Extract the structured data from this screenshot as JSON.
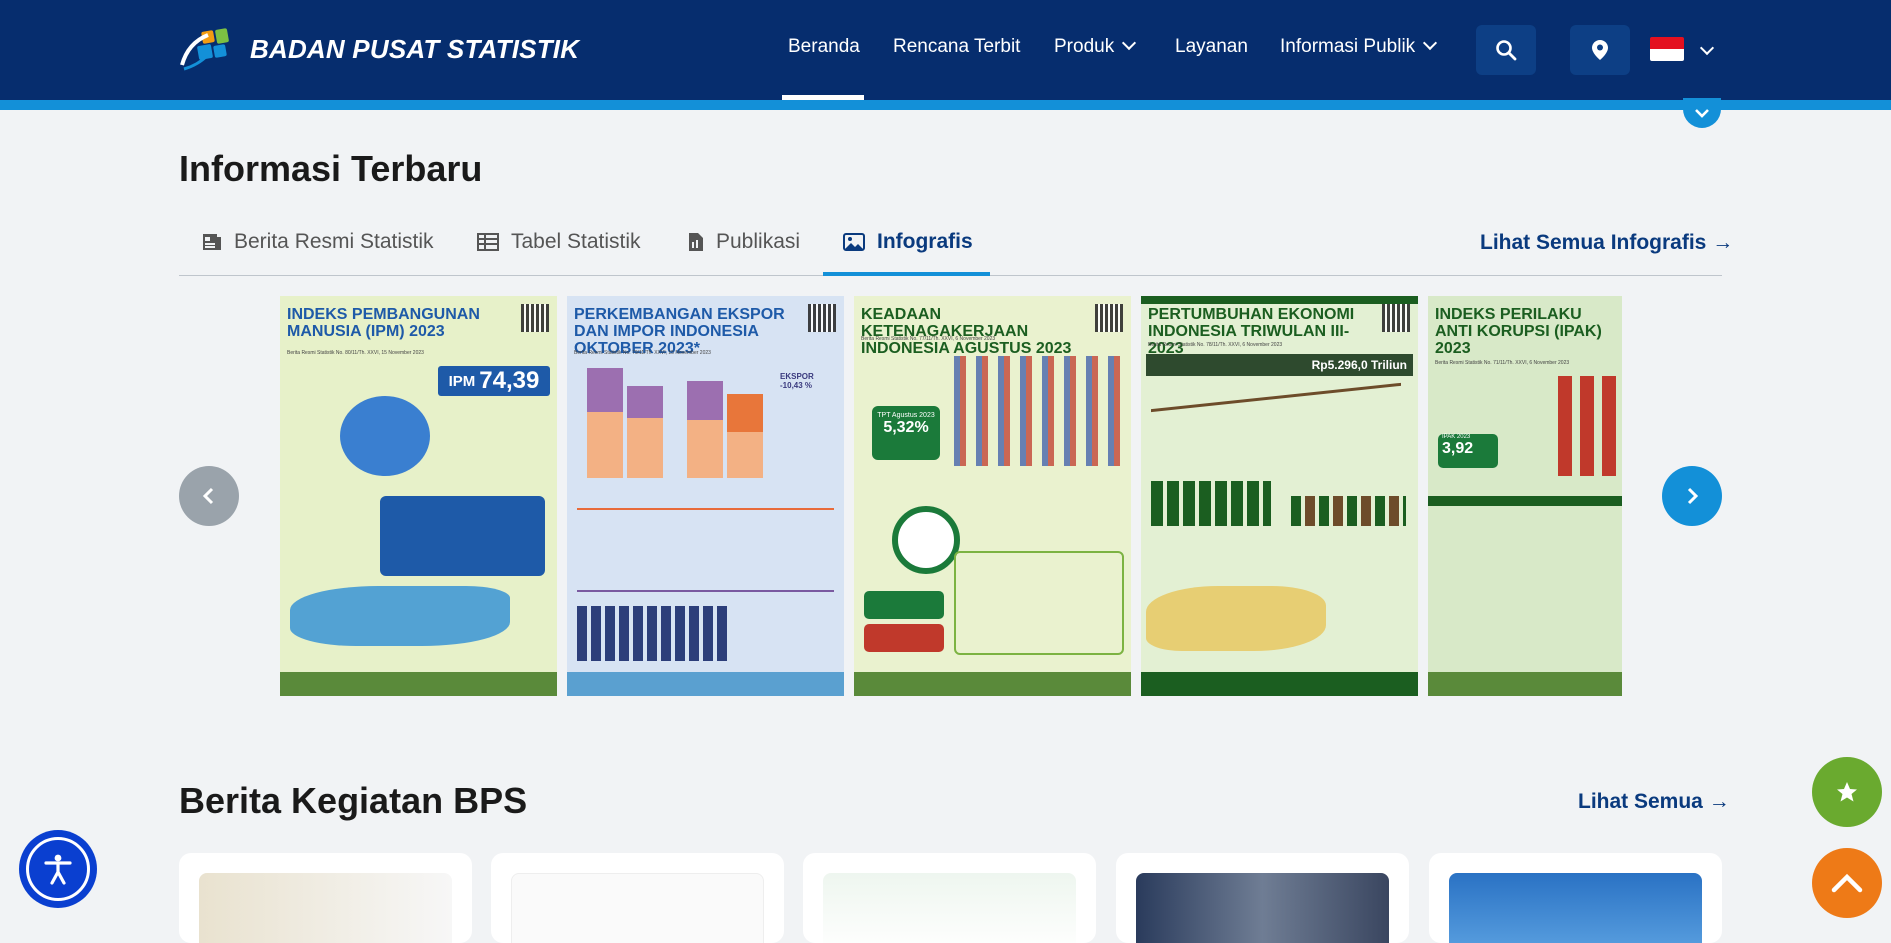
{
  "header": {
    "brand": "BADAN PUSAT STATISTIK",
    "nav": [
      {
        "label": "Beranda",
        "active": true
      },
      {
        "label": "Rencana Terbit"
      },
      {
        "label": "Produk",
        "dropdown": true
      },
      {
        "label": "Layanan"
      },
      {
        "label": "Informasi Publik",
        "dropdown": true
      }
    ],
    "icons": {
      "search": "search-icon",
      "location": "map-pin-icon",
      "language": "indonesia-flag-icon"
    }
  },
  "info_section": {
    "title": "Informasi Terbaru",
    "tabs": [
      {
        "label": "Berita Resmi Statistik",
        "icon": "news-icon"
      },
      {
        "label": "Tabel Statistik",
        "icon": "table-icon"
      },
      {
        "label": "Publikasi",
        "icon": "document-icon"
      },
      {
        "label": "Infografis",
        "icon": "image-icon",
        "active": true
      }
    ],
    "see_all": "Lihat Semua Infografis →",
    "infographics": [
      {
        "title": "INDEKS PEMBANGUNAN MANUSIA (IPM) 2023",
        "subtitle": "Berita Resmi Statistik No. 80/11/Th. XXVI, 15 November 2023",
        "highlight_label": "IPM",
        "highlight_value": "74,39",
        "color": "#1e5aa8"
      },
      {
        "title": "PERKEMBANGAN EKSPOR DAN IMPOR INDONESIA OKTOBER 2023*",
        "subtitle": "Berita Resmi Statistik No. 79/11/Th. XXVI, 15 November 2023",
        "highlight_label": "EKSPOR",
        "highlight_value": "-10,43 %",
        "color": "#1e5aa8"
      },
      {
        "title": "KEADAAN KETENAGAKERJAAN INDONESIA AGUSTUS 2023",
        "subtitle": "Berita Resmi Statistik No. 77/11/Th. XXVI, 6 November 2023",
        "highlight_label": "TPT Agustus 2023",
        "highlight_value": "5,32%",
        "color": "#1b5e20"
      },
      {
        "title": "PERTUMBUHAN EKONOMI INDONESIA TRIWULAN III-2023",
        "subtitle": "Berita Resmi Statistik No. 78/11/Th. XXVI, 6 November 2023",
        "highlight_label": "",
        "highlight_value": "Rp5.296,0 Triliun",
        "color": "#1b5e20"
      },
      {
        "title": "INDEKS PERILAKU ANTI KORUPSI (IPAK) 2023",
        "subtitle": "Berita Resmi Statistik No. 71/11/Th. XXVI, 6 November 2023",
        "highlight_label": "IPAK 2023",
        "highlight_value": "3,92",
        "color": "#1b5e20"
      }
    ]
  },
  "news_section": {
    "title": "Berita Kegiatan BPS",
    "see_all": "Lihat Semua →"
  },
  "floating": {
    "favorite": "star-icon",
    "scroll_top": "chevron-up-icon",
    "accessibility": "accessibility-icon"
  },
  "colors": {
    "header": "#062d6e",
    "accent": "#1390d8",
    "link": "#0a3a7e",
    "fav": "#6aaa2f",
    "top": "#ee7a17"
  }
}
